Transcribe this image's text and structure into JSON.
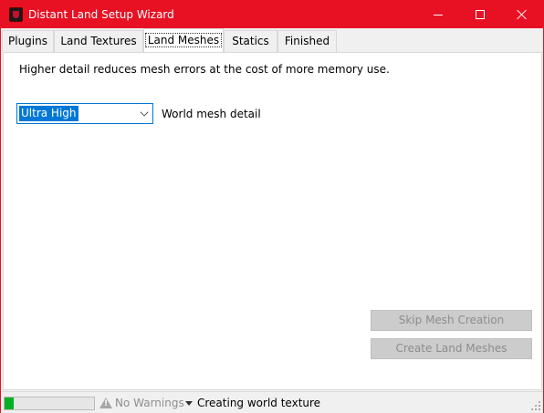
{
  "window": {
    "title": "Distant Land Setup Wizard",
    "accent_color": "#e81123",
    "caption_icons": [
      "minimize-icon",
      "maximize-icon",
      "close-icon"
    ]
  },
  "tabs": [
    {
      "label": "Plugins",
      "active": false
    },
    {
      "label": "Land Textures",
      "active": false
    },
    {
      "label": "Land Meshes",
      "active": true
    },
    {
      "label": "Statics",
      "active": false
    },
    {
      "label": "Finished",
      "active": false
    }
  ],
  "land_meshes": {
    "description": "Higher detail reduces mesh errors at the cost of more memory use.",
    "mesh_detail": {
      "selected": "Ultra High",
      "label": "World mesh detail"
    },
    "skip_button": "Skip Mesh Creation",
    "create_button": "Create Land Meshes"
  },
  "status": {
    "progress_fraction": 0.1,
    "warnings": "No Warnings",
    "message": "Creating world texture"
  }
}
